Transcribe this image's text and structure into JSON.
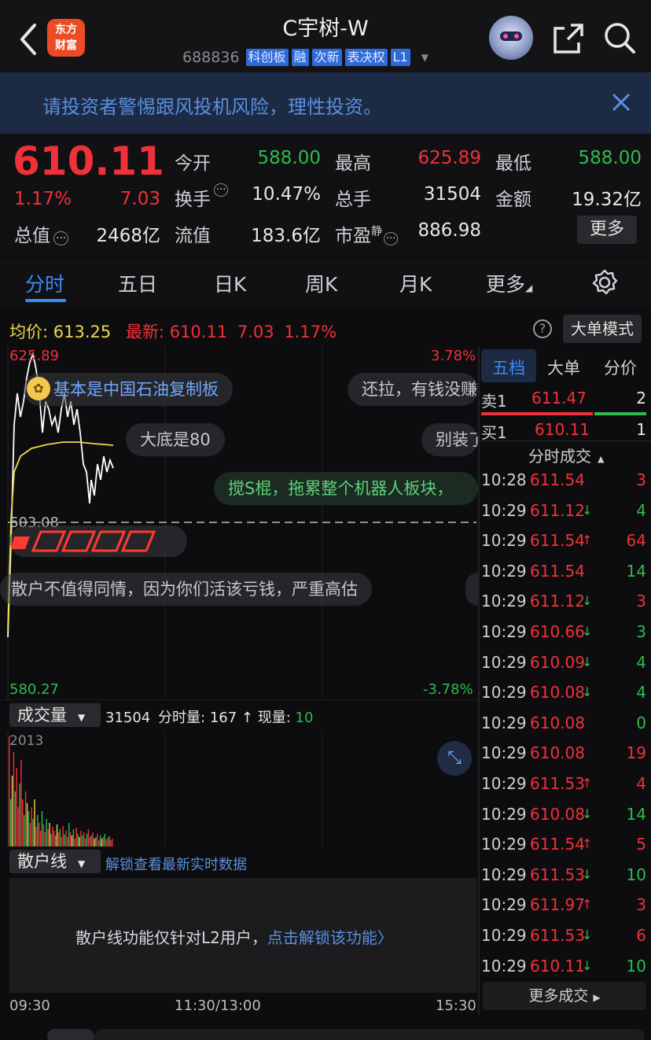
{
  "header": {
    "logo_text": "东方\n财富",
    "title": "C宇树-W",
    "code": "688836",
    "tags": [
      "科创板",
      "融",
      "次新",
      "表决权",
      "L1"
    ]
  },
  "warning": {
    "text": "请投资者警惕跟风投机风险，理性投资。"
  },
  "quote": {
    "price": "610.11",
    "change_pct": "1.17%",
    "change": "7.03",
    "fields": [
      {
        "label": "今开",
        "value": "588.00",
        "color": "green"
      },
      {
        "label": "最高",
        "value": "625.89",
        "color": "red"
      },
      {
        "label": "最低",
        "value": "588.00",
        "color": "green"
      },
      {
        "label": "换手",
        "value": "10.47%",
        "color": "white"
      },
      {
        "label": "总手",
        "value": "31504",
        "color": "white"
      },
      {
        "label": "金额",
        "value": "19.32亿",
        "color": "white"
      },
      {
        "label": "总值",
        "value": "2468亿",
        "color": "white"
      },
      {
        "label": "流值",
        "value": "183.6亿",
        "color": "white"
      },
      {
        "label": "市盈",
        "sup": "静",
        "value": "886.98",
        "color": "white"
      }
    ],
    "more_button": "更多"
  },
  "tabs": [
    "分时",
    "五日",
    "日K",
    "周K",
    "月K",
    "更多"
  ],
  "chart_info": {
    "avg_label": "均价:",
    "avg_value": "613.25",
    "latest_label": "最新:",
    "latest_value": "610.11",
    "latest_change": "7.03",
    "latest_pct": "1.17%",
    "mode_button": "大单模式",
    "y_high": "625.89",
    "y_mid": "603.08",
    "y_low": "580.27",
    "pct_high": "3.78%",
    "pct_low": "-3.78%"
  },
  "comments": [
    "基本是中国石油复制板",
    "还拉，有钱没赚",
    "大底是80",
    "别装了",
    "搅S棍，拖累整个机器人板块，",
    "散户不值得同情，因为你们活该亏钱，严重高估"
  ],
  "volume": {
    "selector": "成交量",
    "total": "31504",
    "fen_label": "分时量:",
    "fen_value": "167",
    "now_label": "现量:",
    "now_value": "10",
    "max": "2013"
  },
  "retail": {
    "selector": "散户线",
    "unlock_link": "解锁查看最新实时数据",
    "notice": "散户线功能仅针对L2用户，",
    "notice_link": "点击解锁该功能〉"
  },
  "time_axis": [
    "09:30",
    "11:30/13:00",
    "15:30"
  ],
  "side": {
    "tabs": [
      "五档",
      "大单",
      "分价"
    ],
    "sell1": {
      "label": "卖1",
      "price": "611.47",
      "vol": "2"
    },
    "buy1": {
      "label": "买1",
      "price": "610.11",
      "vol": "1"
    },
    "ticks_title": "分时成交",
    "ticks": [
      {
        "time": "10:28",
        "price": "611.54",
        "arrow": "",
        "vol": "3",
        "pc": "red",
        "vc": "red"
      },
      {
        "time": "10:29",
        "price": "611.12",
        "arrow": "↓",
        "vol": "4",
        "pc": "red",
        "vc": "green"
      },
      {
        "time": "10:29",
        "price": "611.54",
        "arrow": "↑",
        "vol": "64",
        "pc": "red",
        "vc": "red"
      },
      {
        "time": "10:29",
        "price": "611.54",
        "arrow": "",
        "vol": "14",
        "pc": "red",
        "vc": "green"
      },
      {
        "time": "10:29",
        "price": "611.12",
        "arrow": "↓",
        "vol": "3",
        "pc": "red",
        "vc": "red"
      },
      {
        "time": "10:29",
        "price": "610.66",
        "arrow": "↓",
        "vol": "3",
        "pc": "red",
        "vc": "green"
      },
      {
        "time": "10:29",
        "price": "610.09",
        "arrow": "↓",
        "vol": "4",
        "pc": "red",
        "vc": "green"
      },
      {
        "time": "10:29",
        "price": "610.08",
        "arrow": "↓",
        "vol": "4",
        "pc": "red",
        "vc": "green"
      },
      {
        "time": "10:29",
        "price": "610.08",
        "arrow": "",
        "vol": "0",
        "pc": "red",
        "vc": "green"
      },
      {
        "time": "10:29",
        "price": "610.08",
        "arrow": "",
        "vol": "19",
        "pc": "red",
        "vc": "red"
      },
      {
        "time": "10:29",
        "price": "611.53",
        "arrow": "↑",
        "vol": "4",
        "pc": "red",
        "vc": "red"
      },
      {
        "time": "10:29",
        "price": "610.08",
        "arrow": "↓",
        "vol": "14",
        "pc": "red",
        "vc": "green"
      },
      {
        "time": "10:29",
        "price": "611.54",
        "arrow": "↑",
        "vol": "5",
        "pc": "red",
        "vc": "red"
      },
      {
        "time": "10:29",
        "price": "611.53",
        "arrow": "↓",
        "vol": "10",
        "pc": "red",
        "vc": "green"
      },
      {
        "time": "10:29",
        "price": "611.97",
        "arrow": "↑",
        "vol": "3",
        "pc": "red",
        "vc": "red"
      },
      {
        "time": "10:29",
        "price": "611.53",
        "arrow": "↓",
        "vol": "6",
        "pc": "red",
        "vc": "red"
      },
      {
        "time": "10:29",
        "price": "610.11",
        "arrow": "↓",
        "vol": "10",
        "pc": "red",
        "vc": "green"
      }
    ],
    "more_ticks": "更多成交"
  },
  "colors": {
    "up": "#f0313a",
    "down": "#2dbb4e",
    "avg": "#e9d94a",
    "accent": "#3b8bf5"
  }
}
